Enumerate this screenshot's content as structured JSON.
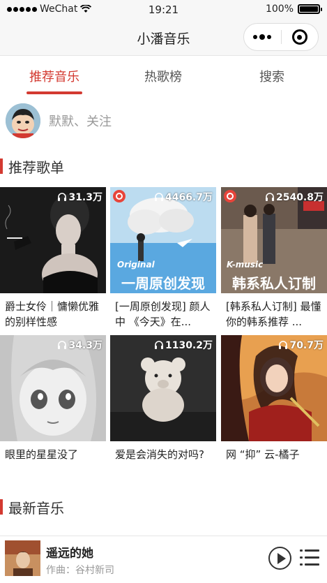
{
  "status_bar": {
    "carrier": "WeChat",
    "time": "19:21",
    "battery": "100%"
  },
  "nav": {
    "title": "小潘音乐",
    "more_icon": "more-dots-icon",
    "close_icon": "close-circle-icon"
  },
  "tabs": [
    {
      "label": "推荐音乐",
      "active": true
    },
    {
      "label": "热歌榜",
      "active": false
    },
    {
      "label": "搜索",
      "active": false
    }
  ],
  "user": {
    "hint": "默默、关注"
  },
  "sections": {
    "recommended": "推荐歌单",
    "latest": "最新音乐"
  },
  "playlists": [
    {
      "title": "爵士女伶｜慵懒优雅的别样性感",
      "count": "31.3万",
      "cover_text": "",
      "badge": false
    },
    {
      "title": "[一周原创发现] 颜人中 《今天》在...",
      "count": "4466.7万",
      "cover_text": "一周原创发现",
      "cover_sub": "Original",
      "badge": true
    },
    {
      "title": "[韩系私人订制] 最懂你的韩系推荐 ...",
      "count": "2540.8万",
      "cover_text": "韩系私人订制",
      "cover_sub": "K-music",
      "badge": true
    },
    {
      "title": "眼里的星星没了",
      "count": "34.3万",
      "cover_text": "",
      "badge": false
    },
    {
      "title": "爱是会消失的对吗?",
      "count": "1130.2万",
      "cover_text": "",
      "badge": false
    },
    {
      "title": "网 “抑” 云-橘子",
      "count": "70.7万",
      "cover_text": "",
      "badge": false
    }
  ],
  "player": {
    "title": "遥远的她",
    "artist": "作曲：谷村新司"
  },
  "colors": {
    "accent": "#d33a31",
    "nav_bg": "#f7f7f7"
  }
}
